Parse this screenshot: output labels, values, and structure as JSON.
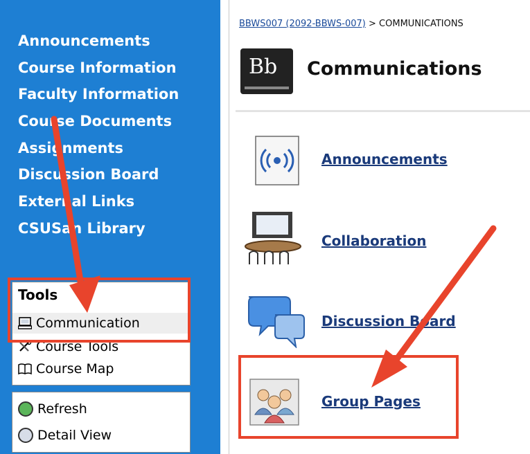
{
  "sidebar": {
    "course_menu": [
      "Announcements",
      "Course Information",
      "Faculty Information",
      "Course Documents",
      "Assignments",
      "Discussion Board",
      "External Links",
      "CSUSan Library"
    ],
    "tools": {
      "header": "Tools",
      "items": [
        {
          "label": "Communication",
          "icon": "monitor-icon"
        },
        {
          "label": "Course Tools",
          "icon": "tools-icon"
        },
        {
          "label": "Course Map",
          "icon": "book-icon"
        }
      ]
    },
    "actions": [
      {
        "label": "Refresh",
        "icon": "refresh-icon"
      },
      {
        "label": "Detail View",
        "icon": "detail-view-icon"
      }
    ]
  },
  "main": {
    "breadcrumb": {
      "course_link": "BBWS007 (2092-BBWS-007)",
      "separator": " > ",
      "current": "COMMUNICATIONS"
    },
    "logo_text": "Bb",
    "title": "Communications",
    "tools": [
      {
        "label": "Announcements",
        "icon": "announcement-icon"
      },
      {
        "label": "Collaboration",
        "icon": "collaboration-icon"
      },
      {
        "label": "Discussion Board",
        "icon": "discussion-icon"
      },
      {
        "label": "Group Pages",
        "icon": "group-pages-icon"
      }
    ]
  },
  "colors": {
    "sidebar_bg": "#1e7fd3",
    "highlight": "#e8442c",
    "link": "#1a3a7a"
  }
}
